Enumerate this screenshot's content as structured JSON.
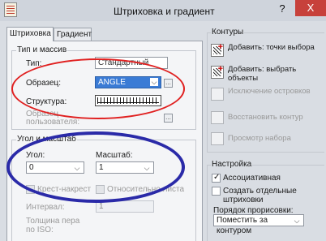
{
  "window": {
    "title": "Штриховка и градиент",
    "help_label": "?",
    "close_label": "X"
  },
  "tabs": [
    {
      "label": "Штриховка",
      "active": true
    },
    {
      "label": "Градиент",
      "active": false
    }
  ],
  "type_pattern": {
    "group_label": "Тип и массив",
    "type_label": "Тип:",
    "type_value": "Стандартный",
    "pattern_label": "Образец:",
    "pattern_value": "ANGLE",
    "swatch_label": "Структура:",
    "custom_label": "Образец пользователя:"
  },
  "angle_scale": {
    "group_label": "Угол и масштаб",
    "angle_label": "Угол:",
    "angle_value": "0",
    "scale_label": "Масштаб:",
    "scale_value": "1",
    "double_label": "Крест-накрест",
    "relative_label": "Относительно листа",
    "spacing_label": "Интервал:",
    "spacing_value": "1",
    "iso_pen_label": "Толщина пера по ISO:"
  },
  "boundaries": {
    "group_label": "Контуры",
    "add_pick": "Добавить: точки выбора",
    "add_select": "Добавить: выбрать объекты",
    "remove": "Исключение островков",
    "recreate": "Восстановить контур",
    "view": "Просмотр набора"
  },
  "options": {
    "group_label": "Настройка",
    "associative_label": "Ассоциативная",
    "associative_checked": true,
    "separate_label": "Создать отдельные штриховки",
    "separate_checked": false,
    "draw_order_label": "Порядок прорисовки:",
    "draw_order_value": "Поместить за контуром"
  },
  "colors": {
    "annotation_red": "#e02020",
    "annotation_blue": "#2a2aa8",
    "selection": "#3a7bd5"
  }
}
